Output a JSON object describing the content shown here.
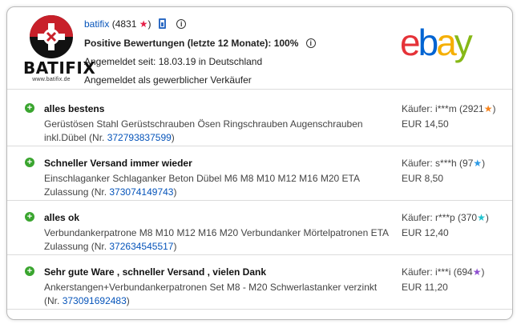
{
  "seller": {
    "logo_word": "BATIFIX",
    "logo_site": "www.batifix.de",
    "name": "batifix",
    "score_open": "(4831",
    "score_close": ")",
    "star_color": "#e62048",
    "positive_label": "Positive Bewertungen (letzte 12 Monate): 100%",
    "since": "Angemeldet seit: 18.03.19 in Deutschland",
    "type": "Angemeldet als gewerblicher Verkäufer"
  },
  "brand": {
    "e": "e",
    "b": "b",
    "a": "a",
    "y": "y"
  },
  "feedback": [
    {
      "title": "alles bestens",
      "desc": "Gerüstösen Stahl Gerüstschrauben Ösen Ringschrauben Augenschrauben inkl.Dübel (Nr.",
      "item_no": "372793837599",
      "tail": ")",
      "buyer": "Käufer: i***m (2921",
      "buyer_close": ")",
      "star": "orange",
      "price": "EUR 14,50"
    },
    {
      "title": "Schneller Versand immer wieder",
      "desc": "Einschlaganker Schlaganker Beton Dübel M6 M8 M10 M12 M16 M20 ETA Zulassung (Nr.",
      "item_no": "373074149743",
      "tail": ")",
      "buyer": "Käufer: s***h (97",
      "buyer_close": ")",
      "star": "blue",
      "price": "EUR 8,50"
    },
    {
      "title": "alles ok",
      "desc": "Verbundankerpatrone M8 M10 M12 M16 M20 Verbundanker Mörtelpatronen ETA Zulassung (Nr.",
      "item_no": "372634545517",
      "tail": ")",
      "buyer": "Käufer: r***p (370",
      "buyer_close": ")",
      "star": "teal",
      "price": "EUR 12,40"
    },
    {
      "title": "Sehr gute Ware , schneller Versand , vielen Dank",
      "desc": "Ankerstangen+Verbundankerpatronen Set M8 - M20 Schwerlastanker verzinkt (Nr.",
      "item_no": "373091692483",
      "tail": ")",
      "buyer": "Käufer: i***i (694",
      "buyer_close": ")",
      "star": "purple",
      "price": "EUR 11,20"
    }
  ]
}
